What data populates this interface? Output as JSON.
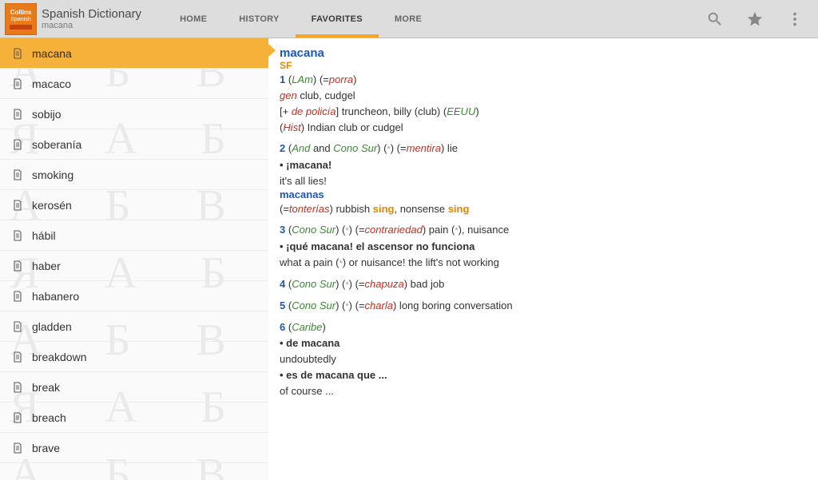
{
  "header": {
    "logo": {
      "l1": "Collins",
      "l2": "Spanish"
    },
    "title": "Spanish Dictionary",
    "subtitle": "macana",
    "tabs": [
      "HOME",
      "HISTORY",
      "FAVORITES",
      "MORE"
    ],
    "active_tab": 2
  },
  "sidebar": {
    "items": [
      "macana",
      "macaco",
      "sobijo",
      "soberanía",
      "smoking",
      "kerosén",
      "hábil",
      "haber",
      "habanero",
      "gladden",
      "breakdown",
      "break",
      "breach",
      "brave"
    ],
    "active": 0
  },
  "entry": {
    "headword": "macana",
    "pos": "SF",
    "s1_num": "1",
    "s1_region": "LAm",
    "s1_xref": "porra",
    "s1_cat": "gen",
    "s1_def": " club, cudgel",
    "s1_b_pre": "[+ ",
    "s1_b_it": "de policía",
    "s1_b_post": "] truncheon, billy (club) (",
    "s1_b_region": "EEUU",
    "s1_b_end": ")",
    "s1_c_pre": "(",
    "s1_c_it": "Hist",
    "s1_c_post": ") Indian club or cudgel",
    "s2_num": "2",
    "s2_r1": "And",
    "s2_and": " and ",
    "s2_r2": "Cono Sur",
    "s2_xref": "mentira",
    "s2_def": " lie",
    "s2_ex1": " • ¡macana!",
    "s2_ex1t": "it's all lies!",
    "s2_sub": "macanas",
    "s2_sub_xref": "tonterías",
    "s2_sub_t1": " rubbish ",
    "s2_sub_sing": "sing",
    "s2_sub_t2": ", nonsense ",
    "s3_num": "3",
    "s3_region": "Cono Sur",
    "s3_xref": "contrariedad",
    "s3_def": " pain (",
    "s3_def2": "), nuisance",
    "s3_ex1": " • ¡qué macana! el ascensor no funciona",
    "s3_ex1t_a": "what a pain (",
    "s3_ex1t_b": ") or nuisance! the lift's not working",
    "s4_num": "4",
    "s4_region": "Cono Sur",
    "s4_xref": "chapuza",
    "s4_def": " bad job",
    "s5_num": "5",
    "s5_region": "Cono Sur",
    "s5_xref": "charla",
    "s5_def": " long boring conversation",
    "s6_num": "6",
    "s6_region": "Caribe",
    "s6_ex1": " • de macana",
    "s6_ex1t": "undoubtedly",
    "s6_ex2": " • es de macana que ...",
    "s6_ex2t": "of course ..."
  }
}
